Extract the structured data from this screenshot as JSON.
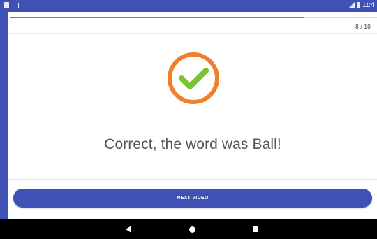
{
  "status_bar": {
    "time": "11:4",
    "left_icons": [
      "sd-card-icon",
      "image-icon"
    ],
    "right_icons": [
      "signal-icon",
      "battery-icon"
    ]
  },
  "progress": {
    "current": 8,
    "total": 10,
    "fraction": 0.8,
    "counter_text": "8 / 10"
  },
  "result": {
    "message": "Correct, the word was Ball!",
    "icon": "checkmark-icon"
  },
  "next_button": {
    "label": "NEXT VIDEO"
  },
  "nav_bar": {
    "items": [
      "back-icon",
      "home-icon",
      "recents-icon"
    ]
  },
  "colors": {
    "primary": "#3f51b5",
    "progress": "#e25a2c",
    "ring": "#ef7f2d",
    "check": "#7bc134",
    "text": "#555555"
  }
}
